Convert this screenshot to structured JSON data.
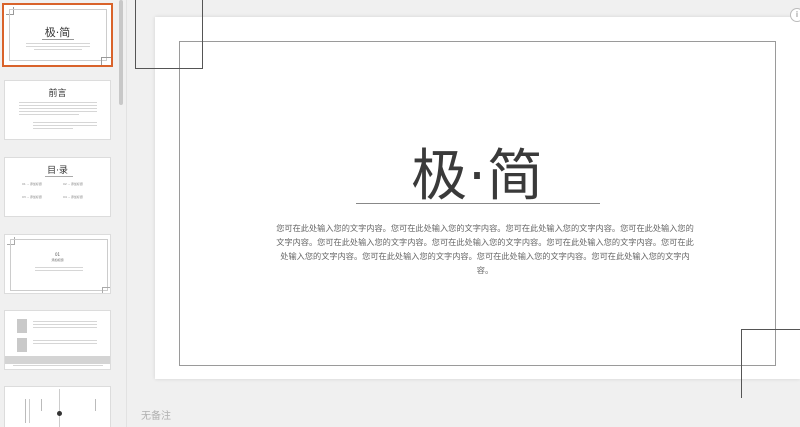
{
  "thumbnails": {
    "slide1": {
      "title": "极·简"
    },
    "slide2": {
      "title": "前言"
    },
    "slide3": {
      "title": "目·录",
      "items": [
        "01 -- 添加标题",
        "02 -- 添加标题",
        "03 -- 添加标题",
        "04 -- 添加标题"
      ]
    },
    "slide4": {
      "number": "01",
      "subtitle": "添加标题"
    }
  },
  "slide": {
    "title": "极·简",
    "body": "您可在此处输入您的文字内容。您可在此处输入您的文字内容。您可在此处输入您的文字内容。您可在此处输入您的文字内容。您可在此处输入您的文字内容。您可在此处输入您的文字内容。您可在此处输入您的文字内容。您可在此处输入您的文字内容。您可在此处输入您的文字内容。您可在此处输入您的文字内容。您可在此处输入您的文字内容。"
  },
  "notes": {
    "placeholder": "无备注"
  },
  "icons": {
    "edge_icon": "info-icon"
  }
}
